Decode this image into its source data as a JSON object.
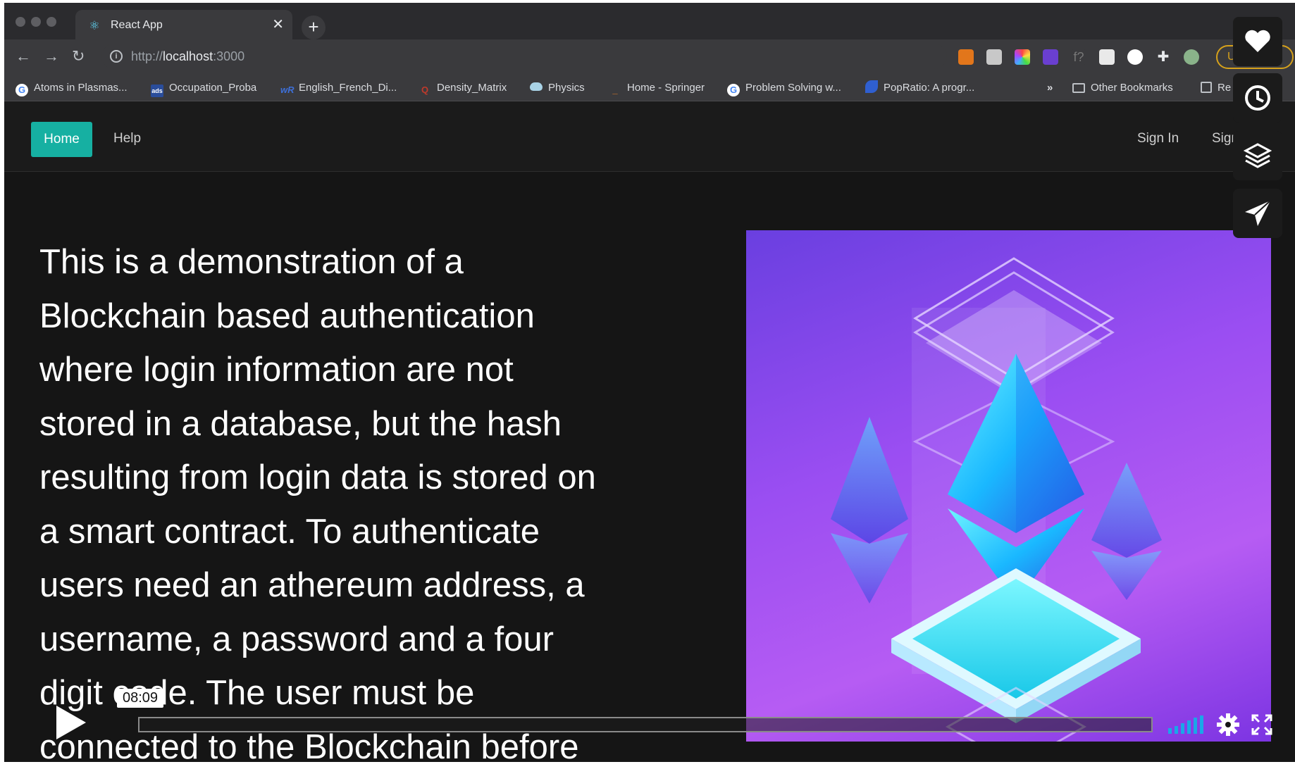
{
  "browser": {
    "tab_title": "React App",
    "tab_close": "✕",
    "new_tab": "+",
    "url_prefix": "http://",
    "url_host": "localhost",
    "url_suffix": ":3000",
    "update_label": "Update",
    "bookmarks": [
      {
        "label": "Atoms in Plasmas...",
        "icon": "google-icon"
      },
      {
        "label": "Occupation_Proba",
        "icon": "ads-icon"
      },
      {
        "label": "English_French_Di...",
        "icon": "wordreference-icon"
      },
      {
        "label": "Density_Matrix",
        "icon": "quora-icon"
      },
      {
        "label": "Physics",
        "icon": "cloud-icon"
      },
      {
        "label": "Home - Springer",
        "icon": "springer-icon"
      },
      {
        "label": "Problem Solving w...",
        "icon": "google-icon"
      },
      {
        "label": "PopRatio: A progr...",
        "icon": "feather-icon"
      }
    ],
    "overflow": "»",
    "other_bookmarks": "Other Bookmarks",
    "reading_list": "Re"
  },
  "navbar": {
    "home": "Home",
    "help": "Help",
    "sign_in": "Sign In",
    "sign_up": "Sign Up"
  },
  "intro_lines": [
    "This is a demonstration of a",
    "Blockchain based authentication",
    "where login information are not",
    "stored in a database, but the hash",
    "resulting from login data is stored on",
    "a smart contract. To authenticate",
    "users need an athereum address, a",
    "username, a password and a four",
    "digit code. The user must be",
    "connected to the Blockchain before"
  ],
  "player": {
    "timecode": "08:09",
    "progress": 0.0
  },
  "colors": {
    "accent": "#16b0a2",
    "app_bg": "#151515",
    "hero_purple": "#9b4ef2",
    "crystal_cyan": "#1de3ff"
  },
  "side_toolbar": [
    "heart-icon",
    "clock-icon",
    "layers-icon",
    "send-icon"
  ]
}
